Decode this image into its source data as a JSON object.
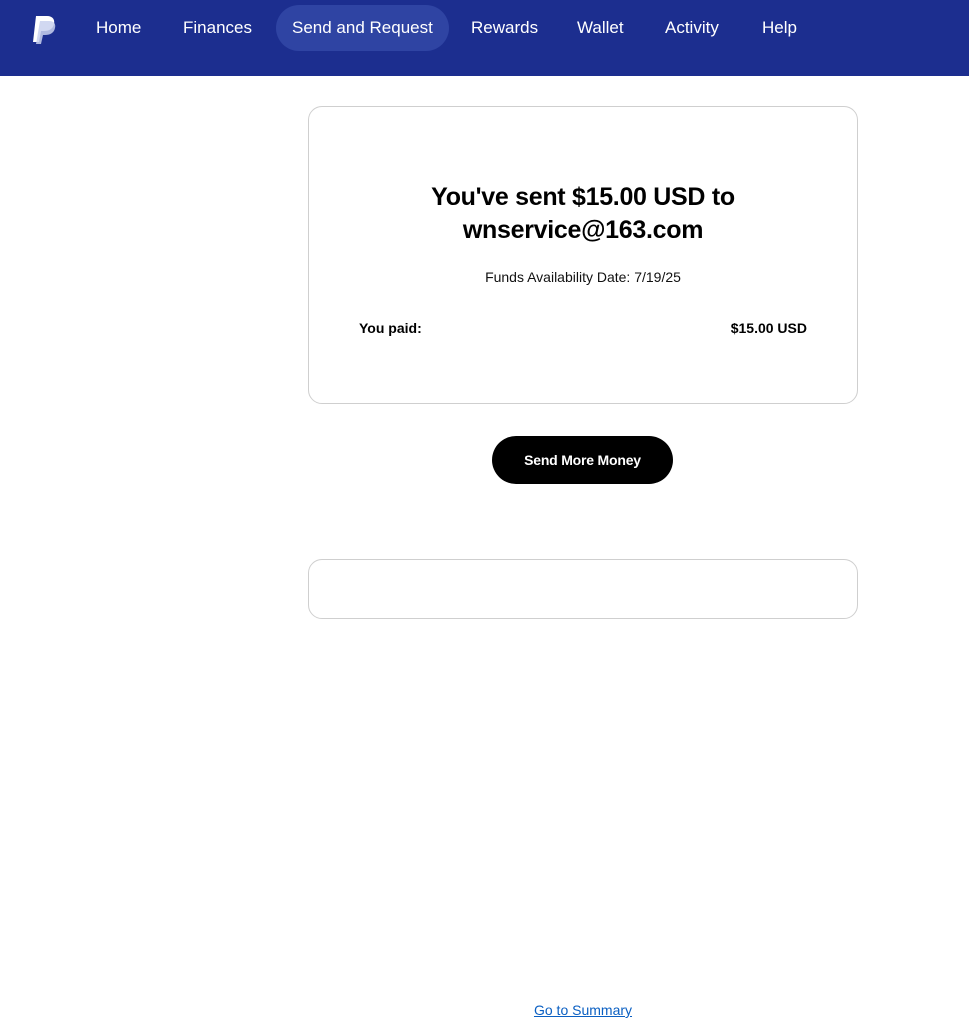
{
  "nav": {
    "items": [
      {
        "label": "Home",
        "active": false
      },
      {
        "label": "Finances",
        "active": false
      },
      {
        "label": "Send and Request",
        "active": true
      },
      {
        "label": "Rewards",
        "active": false
      },
      {
        "label": "Wallet",
        "active": false
      },
      {
        "label": "Activity",
        "active": false
      },
      {
        "label": "Help",
        "active": false
      }
    ],
    "logo_icon": "paypal-logo-icon",
    "background_color": "#1c2e8f",
    "active_pill_color": "#2f44a3"
  },
  "confirmation": {
    "headline_line1": "You've sent $15.00 USD to",
    "headline_line2": "wnservice@163.com",
    "funds_availability": "Funds Availability Date: 7/19/25",
    "paid_label": "You paid:",
    "paid_amount": "$15.00 USD"
  },
  "actions": {
    "send_more_label": "Send More Money",
    "go_to_summary_label": "Go to Summary",
    "link_color": "#0a5fc2"
  }
}
